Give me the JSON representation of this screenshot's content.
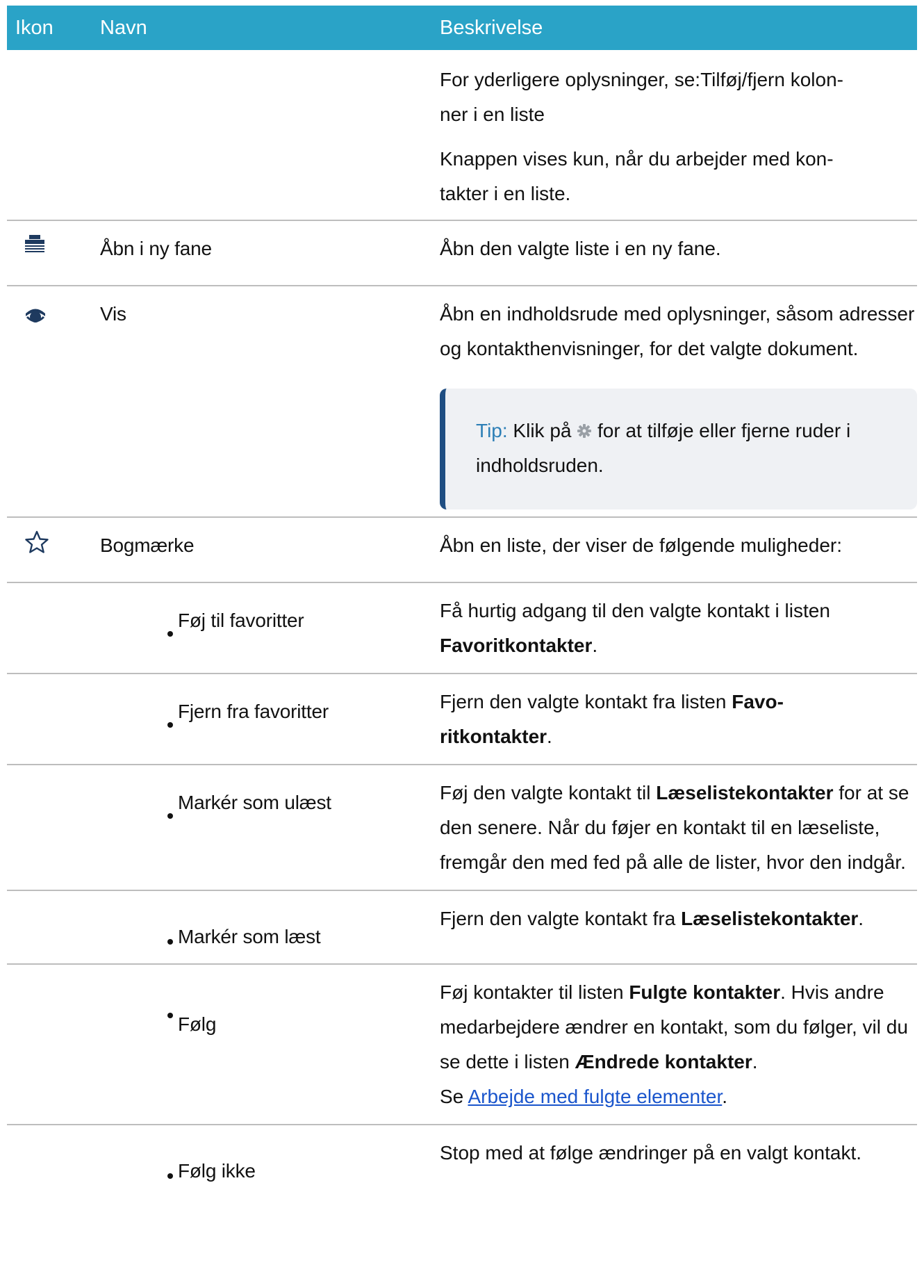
{
  "table": {
    "headers": {
      "icon": "Ikon",
      "name": "Navn",
      "description": "Beskrivelse"
    },
    "top_continuation": {
      "paragraph1": "For yderligere oplysninger, se:Tilføj/fjern kolon-ner i en liste",
      "paragraph1_line1": "For yderligere oplysninger, se:Tilføj/fjern kolon-",
      "paragraph1_line2": "ner i en liste",
      "paragraph2_line1": "Knappen vises kun, når du arbejder med kon-",
      "paragraph2_line2": "takter i en liste."
    },
    "rows": {
      "open_tab": {
        "icon": "open-in-new-tab-icon",
        "name": "Åbn i ny fane",
        "description": "Åbn den valgte liste i en ny fane."
      },
      "view": {
        "icon": "eye-icon",
        "name": "Vis",
        "description": "Åbn en indholdsrude med oplysninger, såsom adresser og kontakthenvisninger, for det valgte dokument.",
        "tip_label": "Tip:",
        "tip_before": "Klik på",
        "tip_icon": "gear-icon",
        "tip_after": "for at tilføje eller fjerne ruder i indholdsruden."
      },
      "bookmark": {
        "icon": "star-icon",
        "name": "Bogmærke",
        "description": "Åbn en liste, der viser de følgende muligheder:"
      },
      "add_favorite": {
        "name": "Føj til favoritter",
        "desc_before": "Få hurtig adgang til den valgte kontakt i listen ",
        "desc_bold": "Favoritkontakter",
        "desc_after": "."
      },
      "remove_favorite": {
        "name": "Fjern fra favoritter",
        "desc_before": "Fjern den valgte kontakt fra listen ",
        "desc_bold_line1": "Favo-",
        "desc_bold_line2": "ritkontakter",
        "desc_after": "."
      },
      "mark_unread": {
        "name": "Markér som ulæst",
        "desc_before": "Føj den valgte kontakt til ",
        "desc_bold": "Læselistekontakter",
        "desc_after": " for at se den senere. Når du føjer en kontakt til en læseliste, fremgår den med fed på alle de lister, hvor den indgår."
      },
      "mark_read": {
        "name": "Markér som læst",
        "desc_before": "Fjern den valgte kontakt fra ",
        "desc_bold": "Læselistekontakter",
        "desc_after": "."
      },
      "follow": {
        "name": "Følg",
        "desc_before": "Føj kontakter til listen ",
        "desc_bold1": "Fulgte kontakter",
        "desc_middle": ". Hvis andre medarbejdere ændrer en kontakt, som du følger, vil du se dette i listen ",
        "desc_bold2": "Ændrede kontakter",
        "desc_after": ".",
        "see_prefix": "Se ",
        "link_text": "Arbejde med fulgte elementer",
        "see_suffix": "."
      },
      "unfollow": {
        "name": "Følg ikke",
        "description": "Stop med at følge ændringer på en valgt kontakt."
      }
    }
  },
  "colors": {
    "header_bg": "#2aa3c7",
    "tip_bar": "#1f4e82",
    "tip_label": "#2d7fb6",
    "link": "#1a55cc"
  }
}
